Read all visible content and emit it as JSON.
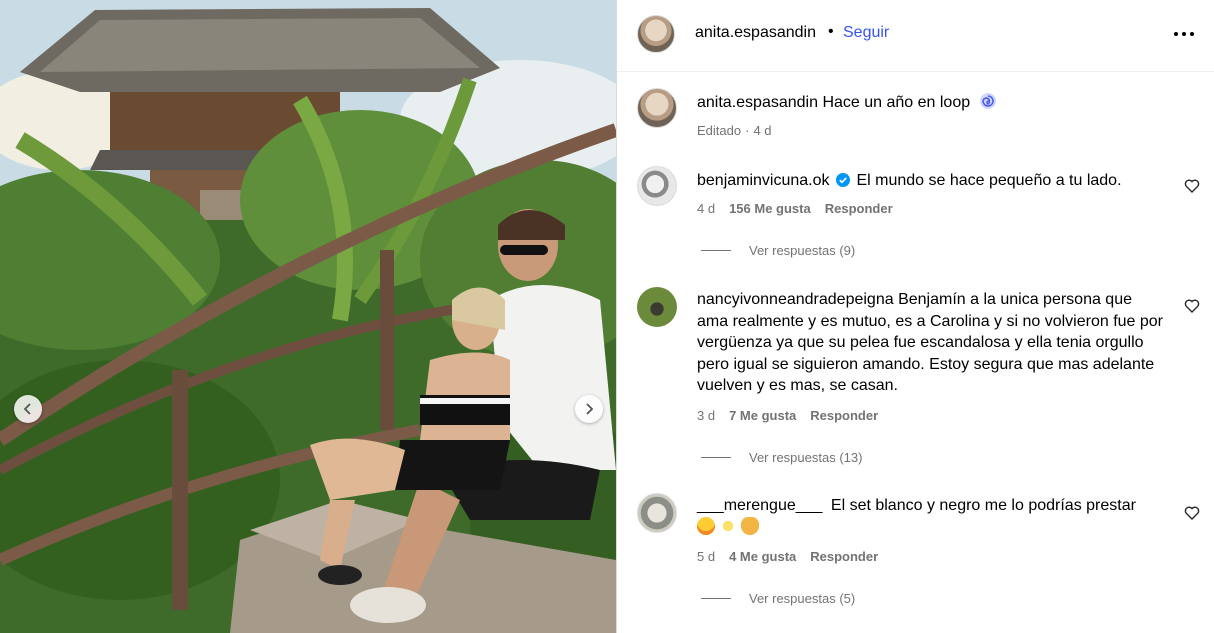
{
  "post": {
    "owner_username": "anita.espasandin",
    "follow_label": "Seguir",
    "separator": "•",
    "caption_text": "Hace un año en loop",
    "caption_meta_edited": "Editado",
    "caption_meta_dot": "·",
    "caption_meta_time": "4 d"
  },
  "comments": [
    {
      "username": "benjaminvicuna.ok",
      "verified": true,
      "text": "El mundo se hace pequeño a tu lado.",
      "time": "4 d",
      "likes": "156 Me gusta",
      "reply_label": "Responder",
      "view_replies": "Ver respuestas (9)"
    },
    {
      "username": "nancyivonneandradepeigna",
      "text": "Benjamín a la unica persona que ama realmente y es mutuo, es a Carolina y si no volvieron fue por vergüenza ya que su pelea fue escandalosa y ella tenia orgullo pero igual se siguieron amando. Estoy segura que mas adelante vuelven y es mas, se casan.",
      "time": "3 d",
      "likes": "7 Me gusta",
      "reply_label": "Responder",
      "view_replies": "Ver respuestas (13)"
    },
    {
      "username": "___merengue___",
      "text": "El set blanco y negro me lo podrías prestar",
      "emojis": [
        "grinning-squinting-face",
        "sparkles",
        "heart-hands"
      ],
      "time": "5 d",
      "likes": "4 Me gusta",
      "reply_label": "Responder",
      "view_replies": "Ver respuestas (5)"
    }
  ],
  "colors": {
    "link_blue": "#3753f0",
    "meta_gray": "#737373",
    "verified_blue": "#0095f6",
    "divider": "#dbdbdb"
  },
  "icons": {
    "more": "more-options-icon",
    "heart": "heart-outline-icon",
    "loop": "loop-swirl-icon",
    "prev": "chevron-left-icon",
    "next": "chevron-right-icon",
    "verified": "verified-badge-icon"
  }
}
